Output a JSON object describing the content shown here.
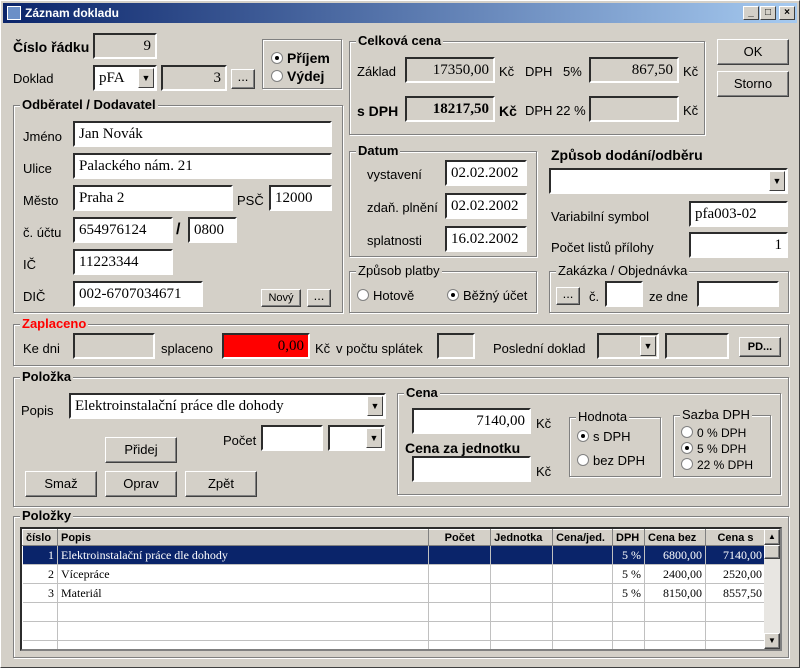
{
  "window": {
    "title": "Záznam dokladu"
  },
  "cislo_radku": {
    "label": "Číslo řádku",
    "value": "9"
  },
  "doklad": {
    "label": "Doklad",
    "type": "pFA",
    "number": "3",
    "browse": "..."
  },
  "smer": {
    "prijem": "Příjem",
    "vydej": "Výdej",
    "selected": "prijem"
  },
  "odberatel": {
    "legend": "Odběratel / Dodavatel",
    "jmeno_label": "Jméno",
    "jmeno": "Jan Novák",
    "ulice_label": "Ulice",
    "ulice": "Palackého nám. 21",
    "mesto_label": "Město",
    "mesto": "Praha 2",
    "psc_label": "PSČ",
    "psc": "12000",
    "ucet_label": "č. účtu",
    "ucet": "654976124",
    "ucet_slash": "/",
    "banka": "0800",
    "ic_label": "IČ",
    "ic": "11223344",
    "dic_label": "DIČ",
    "dic": "002-6707034671",
    "novy": "Nový",
    "browse": "..."
  },
  "celkova_cena": {
    "legend": "Celková cena",
    "zaklad_label": "Základ",
    "zaklad": "17350,00",
    "kc1": "Kč",
    "dph5_label": "DPH",
    "dph5_rate": "5%",
    "dph5": "867,50",
    "kc2": "Kč",
    "sdph_label": "s DPH",
    "sdph": "18217,50",
    "kc3": "Kč",
    "dph22_label": "DPH 22 %",
    "dph22": "",
    "kc4": "Kč"
  },
  "buttons": {
    "ok": "OK",
    "storno": "Storno"
  },
  "datum": {
    "legend": "Datum",
    "vystaveni_label": "vystavení",
    "vystaveni": "02.02.2002",
    "zdan_label": "zdaň. plnění",
    "zdan": "02.02.2002",
    "splatnost_label": "splatnosti",
    "splatnost": "16.02.2002"
  },
  "zpusob_dodani": {
    "label": "Způsob dodání/odběru",
    "value": ""
  },
  "variabilni": {
    "label": "Variabilní symbol",
    "value": "pfa003-02"
  },
  "pocet_listu": {
    "label": "Počet listů přílohy",
    "value": "1"
  },
  "platba": {
    "legend": "Způsob platby",
    "hotove": "Hotově",
    "bezny": "Běžný účet",
    "selected": "bezny"
  },
  "zakazka": {
    "legend": "Zakázka / Objednávka",
    "browse": "...",
    "c_label": "č.",
    "c": "",
    "ze_dne_label": "ze dne",
    "ze_dne": ""
  },
  "zaplaceno": {
    "legend": "Zaplaceno",
    "ke_dni_label": "Ke dni",
    "ke_dni": "",
    "splaceno_label": "splaceno",
    "splaceno": "0,00",
    "kc": "Kč",
    "splatek_label": "v počtu splátek",
    "splatek": "",
    "posledni_label": "Poslední doklad",
    "pd_button": "PD...",
    "accent": "#ff0000"
  },
  "polozka": {
    "legend": "Položka",
    "popis_label": "Popis",
    "popis": "Elektroinstalační práce dle dohody",
    "pridej": "Přidej",
    "pocet_label": "Počet",
    "pocet": "",
    "smaz": "Smaž",
    "oprav": "Oprav",
    "zpet": "Zpět"
  },
  "cena": {
    "legend": "Cena",
    "value": "7140,00",
    "kc": "Kč",
    "za_jednotku_label": "Cena za jednotku",
    "za_jednotku": "",
    "kc2": "Kč"
  },
  "hodnota": {
    "legend": "Hodnota",
    "s_dph": "s DPH",
    "bez_dph": "bez DPH",
    "selected": "s_dph"
  },
  "sazba": {
    "legend": "Sazba DPH",
    "r0": "0 % DPH",
    "r5": "5 % DPH",
    "r22": "22 % DPH",
    "selected": "r5"
  },
  "polozky": {
    "legend": "Položky",
    "columns": [
      "číslo",
      "Popis",
      "Počet",
      "Jednotka",
      "Cena/jed.",
      "DPH",
      "Cena bez",
      "Cena s"
    ],
    "rows": [
      {
        "cislo": "1",
        "popis": "Elektroinstalační práce dle dohody",
        "pocet": "",
        "jednotka": "",
        "cena_jed": "",
        "dph": "5 %",
        "bez": "6800,00",
        "s": "7140,00"
      },
      {
        "cislo": "2",
        "popis": "Vícepráce",
        "pocet": "",
        "jednotka": "",
        "cena_jed": "",
        "dph": "5 %",
        "bez": "2400,00",
        "s": "2520,00"
      },
      {
        "cislo": "3",
        "popis": "Materiál",
        "pocet": "",
        "jednotka": "",
        "cena_jed": "",
        "dph": "5 %",
        "bez": "8150,00",
        "s": "8557,50"
      }
    ]
  }
}
